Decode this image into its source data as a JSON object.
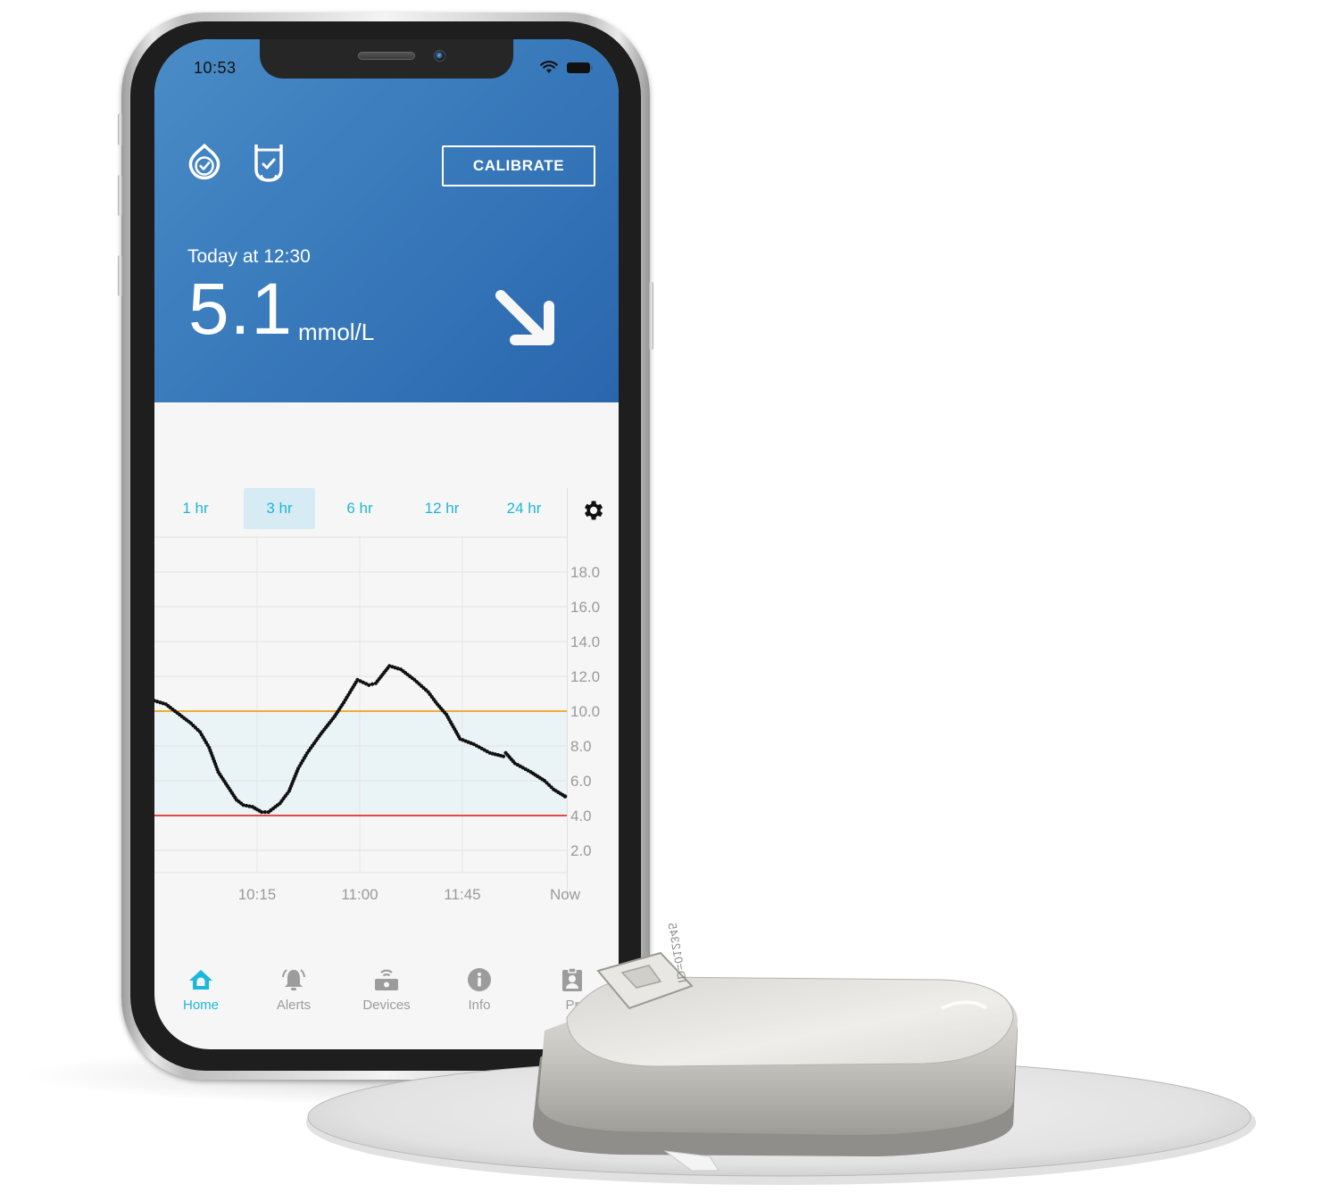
{
  "status_bar": {
    "time": "10:53",
    "wifi_icon": "wifi-icon",
    "battery_icon": "battery-icon"
  },
  "header": {
    "sensor_status_icon": "drop-check-icon",
    "transmitter_status_icon": "transmitter-check-icon",
    "calibrate_label": "CALIBRATE",
    "reading_time": "Today at 12:30",
    "glucose_value": "5.1",
    "glucose_unit": "mmol/L",
    "trend_icon": "arrow-down-right-icon",
    "trend": "falling",
    "colors": {
      "header_gradient_start": "#4a8cc6",
      "header_gradient_end": "#2a66ae"
    }
  },
  "range_tabs": {
    "items": [
      {
        "label": "1 hr",
        "active": false
      },
      {
        "label": "3 hr",
        "active": true
      },
      {
        "label": "6 hr",
        "active": false
      },
      {
        "label": "12 hr",
        "active": false
      },
      {
        "label": "24 hr",
        "active": false
      }
    ],
    "settings_icon": "gear-icon",
    "accent": "#1fb6d8"
  },
  "chart_data": {
    "type": "line",
    "title": "",
    "xlabel": "",
    "ylabel": "",
    "unit": "mmol/L",
    "x_tick_labels": [
      "10:15",
      "11:00",
      "11:45",
      "Now"
    ],
    "x_tick_minutes": [
      615,
      660,
      705,
      750
    ],
    "xlim_minutes": [
      570,
      750
    ],
    "y_ticks": [
      "18.0",
      "16.0",
      "14.0",
      "12.0",
      "10.0",
      "8.0",
      "6.0",
      "4.0",
      "2.0"
    ],
    "ylim": [
      0,
      20
    ],
    "grid": true,
    "target_range": {
      "low": 4.0,
      "high": 10.0,
      "fill": "#eaf3f6"
    },
    "high_threshold": {
      "value": 10.0,
      "color": "#f0a31a"
    },
    "low_threshold": {
      "value": 4.0,
      "color": "#e3312b"
    },
    "series": [
      {
        "name": "Glucose",
        "color": "#111111",
        "points": [
          [
            "09:30",
            10.6
          ],
          [
            "09:35",
            10.4
          ],
          [
            "09:41",
            9.8
          ],
          [
            "09:46",
            9.3
          ],
          [
            "09:50",
            8.8
          ],
          [
            "09:54",
            7.9
          ],
          [
            "09:58",
            6.5
          ],
          [
            "10:02",
            5.7
          ],
          [
            "10:06",
            4.9
          ],
          [
            "10:09",
            4.6
          ],
          [
            "10:13",
            4.5
          ],
          [
            "10:17",
            4.2
          ],
          [
            "10:20",
            4.2
          ],
          [
            "10:25",
            4.7
          ],
          [
            "10:29",
            5.4
          ],
          [
            "10:33",
            6.7
          ],
          [
            "10:37",
            7.6
          ],
          [
            "10:43",
            8.7
          ],
          [
            "10:49",
            9.7
          ],
          [
            "10:53",
            10.5
          ],
          [
            "10:59",
            11.8
          ],
          [
            "11:04",
            11.5
          ],
          [
            "11:07",
            11.6
          ],
          [
            "11:13",
            12.6
          ],
          [
            "11:18",
            12.4
          ],
          [
            "11:24",
            11.8
          ],
          [
            "11:30",
            11.1
          ],
          [
            "11:34",
            10.4
          ],
          [
            "11:38",
            9.8
          ],
          [
            "11:44",
            8.4
          ],
          [
            "11:50",
            8.1
          ],
          [
            "11:57",
            7.6
          ],
          [
            "12:03",
            7.4
          ],
          [
            "12:04",
            7.6
          ],
          [
            "12:08",
            7.0
          ],
          [
            "12:15",
            6.5
          ],
          [
            "12:21",
            6.0
          ],
          [
            "12:25",
            5.5
          ],
          [
            "12:30",
            5.1
          ]
        ]
      }
    ]
  },
  "bottom_nav": {
    "items": [
      {
        "label": "Home",
        "icon": "home-icon",
        "active": true
      },
      {
        "label": "Alerts",
        "icon": "bell-icon",
        "active": false
      },
      {
        "label": "Devices",
        "icon": "transmitter-icon",
        "active": false
      },
      {
        "label": "Info",
        "icon": "info-icon",
        "active": false
      },
      {
        "label": "Pr",
        "icon": "profile-badge-icon",
        "active": false
      }
    ],
    "active_color": "#1cb8dc",
    "inactive_color": "#9c9c9c"
  },
  "sensor_device": {
    "label": "ID=012345"
  }
}
